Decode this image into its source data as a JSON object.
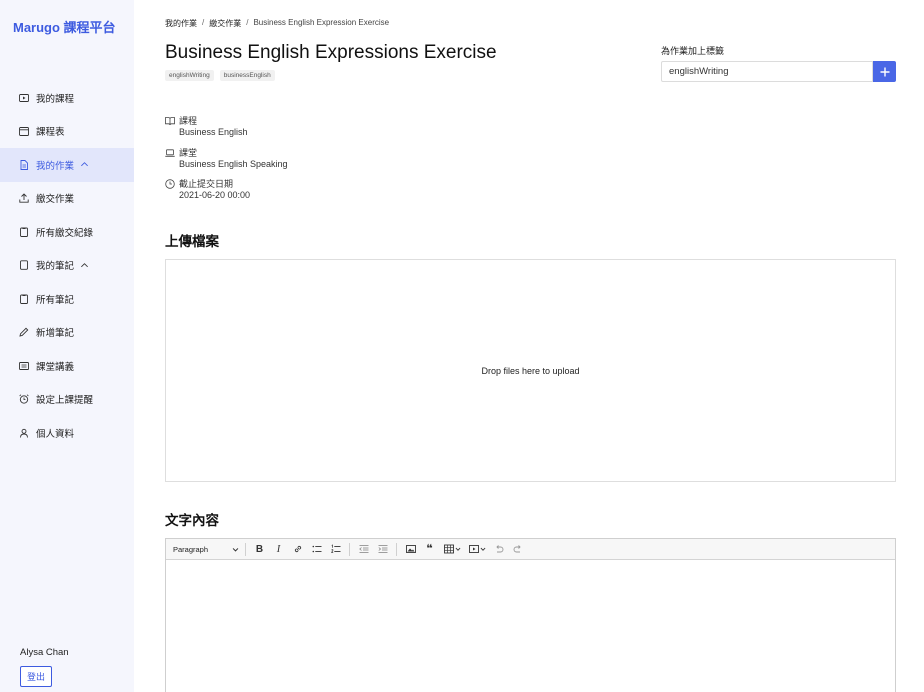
{
  "sidebar": {
    "brand": "Marugo 課程平台",
    "items": [
      {
        "label": "我的課程",
        "icon": "play-square-icon"
      },
      {
        "label": "課程表",
        "icon": "calendar-icon"
      },
      {
        "label": "我的作業",
        "icon": "file-text-icon",
        "active": true,
        "expanded": true
      },
      {
        "label": "繳交作業",
        "icon": "upload-icon"
      },
      {
        "label": "所有繳交紀錄",
        "icon": "clipboard-icon"
      },
      {
        "label": "我的筆記",
        "icon": "notebook-icon",
        "expanded": true
      },
      {
        "label": "所有筆記",
        "icon": "clipboard-icon"
      },
      {
        "label": "新增筆記",
        "icon": "pencil-icon"
      },
      {
        "label": "課堂講義",
        "icon": "handout-icon"
      },
      {
        "label": "設定上課提醒",
        "icon": "alarm-clock-icon"
      },
      {
        "label": "個人資料",
        "icon": "user-icon"
      }
    ],
    "user_name": "Alysa Chan",
    "logout_label": "登出"
  },
  "breadcrumb": [
    "我的作業",
    "繳交作業",
    "Business English Expression Exercise"
  ],
  "breadcrumb_sep": "/",
  "assignment": {
    "title": "Business English Expressions Exercise",
    "tags": [
      "englishWriting",
      "businessEnglish"
    ],
    "meta": [
      {
        "label": "課程",
        "value": "Business English",
        "icon": "book-open-icon"
      },
      {
        "label": "課堂",
        "value": "Business English Speaking",
        "icon": "laptop-icon"
      },
      {
        "label": "截止提交日期",
        "value": "2021-06-20 00:00",
        "icon": "clock-icon"
      }
    ]
  },
  "tag_form": {
    "label": "為作業加上標籤",
    "value": "englishWriting",
    "add_icon": "plus-icon"
  },
  "upload": {
    "heading": "上傳檔案",
    "dropzone_text": "Drop files here to upload"
  },
  "text_content": {
    "heading": "文字內容",
    "paragraph_select": "Paragraph"
  },
  "colors": {
    "accent": "#3d5be0",
    "sidebar_bg": "#f5f6fd",
    "active_bg": "#e2e6fb",
    "button": "#4a67e6"
  }
}
